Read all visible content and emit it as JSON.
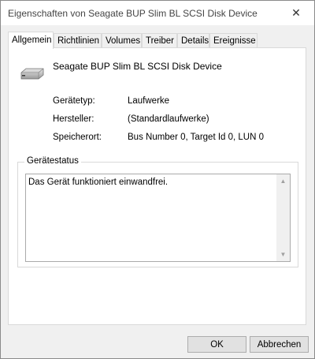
{
  "window": {
    "title": "Eigenschaften von Seagate BUP Slim BL SCSI Disk Device",
    "close_symbol": "✕"
  },
  "tabs": [
    "Allgemein",
    "Richtlinien",
    "Volumes",
    "Treiber",
    "Details",
    "Ereignisse"
  ],
  "active_tab": "Allgemein",
  "device": {
    "icon": "disk-drive-icon",
    "name": "Seagate BUP Slim BL SCSI Disk Device"
  },
  "properties": [
    {
      "label": "Gerätetyp:",
      "value": "Laufwerke"
    },
    {
      "label": "Hersteller:",
      "value": "(Standardlaufwerke)"
    },
    {
      "label": "Speicherort:",
      "value": "Bus Number 0, Target Id 0, LUN 0"
    }
  ],
  "status": {
    "group_title": "Gerätestatus",
    "text": "Das Gerät funktioniert einwandfrei.",
    "scroll_up": "▲",
    "scroll_down": "▼"
  },
  "buttons": {
    "ok": "OK",
    "cancel": "Abbrechen"
  }
}
